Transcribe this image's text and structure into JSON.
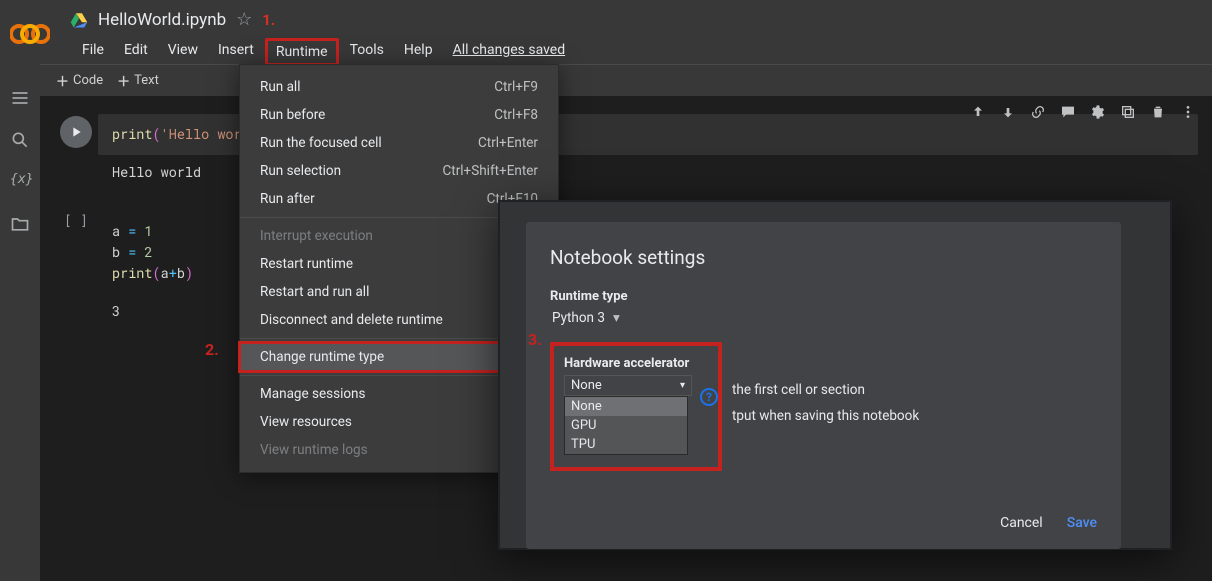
{
  "header": {
    "filename": "HelloWorld.ipynb",
    "saved_label": "All changes saved"
  },
  "annotations": {
    "a1": "1.",
    "a2": "2.",
    "a3": "3."
  },
  "menubar": {
    "file": "File",
    "edit": "Edit",
    "view": "View",
    "insert": "Insert",
    "runtime": "Runtime",
    "tools": "Tools",
    "help": "Help"
  },
  "toolbar": {
    "code": "Code",
    "text": "Text"
  },
  "cells": {
    "c1_code": "print('Hello world')",
    "c1_out": "Hello world",
    "c2_l1": "a = 1",
    "c2_l2": "b = 2",
    "c2_l3": "print(a+b)",
    "c2_out": "3",
    "bracket": "[ ]"
  },
  "dropdown": {
    "run_all": {
      "label": "Run all",
      "shortcut": "Ctrl+F9"
    },
    "run_before": {
      "label": "Run before",
      "shortcut": "Ctrl+F8"
    },
    "run_focused": {
      "label": "Run the focused cell",
      "shortcut": "Ctrl+Enter"
    },
    "run_selection": {
      "label": "Run selection",
      "shortcut": "Ctrl+Shift+Enter"
    },
    "run_after": {
      "label": "Run after",
      "shortcut": "Ctrl+F10"
    },
    "interrupt": {
      "label": "Interrupt execution"
    },
    "restart": {
      "label": "Restart runtime"
    },
    "restart_all": {
      "label": "Restart and run all"
    },
    "disconnect": {
      "label": "Disconnect and delete runtime"
    },
    "change_type": {
      "label": "Change runtime type"
    },
    "manage": {
      "label": "Manage sessions"
    },
    "resources": {
      "label": "View resources"
    },
    "logs": {
      "label": "View runtime logs"
    }
  },
  "modal": {
    "title": "Notebook settings",
    "runtime_type_label": "Runtime type",
    "runtime_type_value": "Python 3",
    "hw_label": "Hardware accelerator",
    "hw_value": "None",
    "options": {
      "o0": "None",
      "o1": "GPU",
      "o2": "TPU"
    },
    "hint1": "the first cell or section",
    "hint2": "tput when saving this notebook",
    "cancel": "Cancel",
    "save": "Save"
  }
}
